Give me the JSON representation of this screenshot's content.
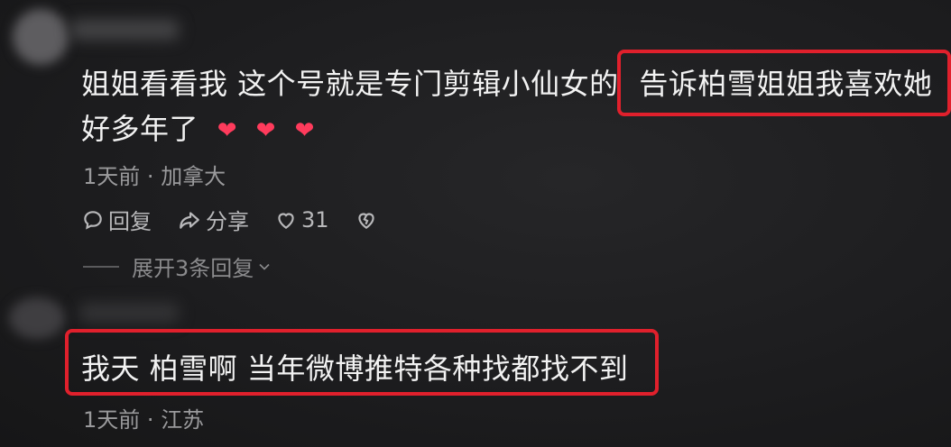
{
  "comments": [
    {
      "text_line1_a": "姐姐看看我 这个号就是专门剪辑小仙女的",
      "text_line1_b": "告诉柏雪姐姐我喜欢她",
      "text_line2": "好多年了",
      "hearts": [
        "❤",
        "❤",
        "❤"
      ],
      "time": "1天前",
      "location": "加拿大",
      "reply_label": "回复",
      "share_label": "分享",
      "like_count": "31",
      "expand_replies": "展开3条回复"
    },
    {
      "text": "我天 柏雪啊 当年微博推特各种找都找不到",
      "time": "1天前",
      "location": "江苏"
    }
  ],
  "colors": {
    "highlight": "#e0202c",
    "heart": "#ff3b5c"
  }
}
